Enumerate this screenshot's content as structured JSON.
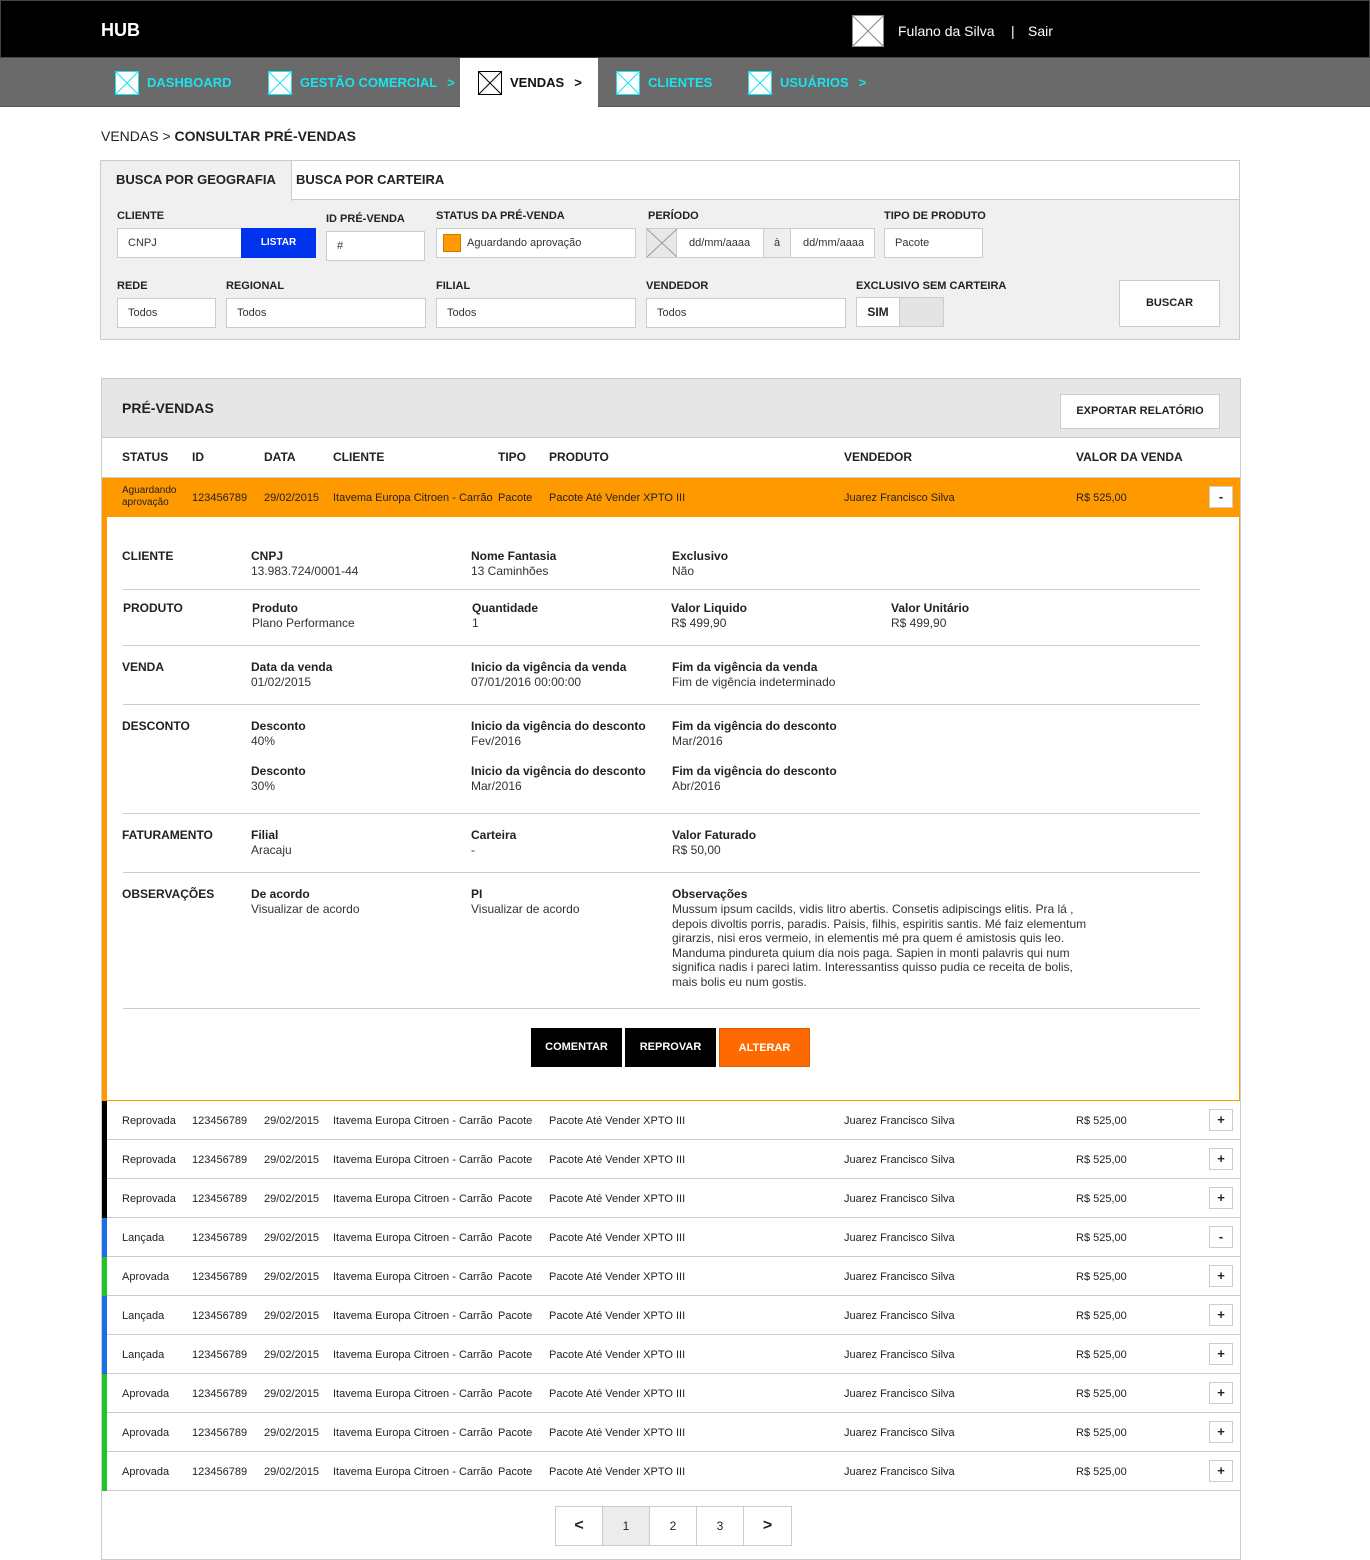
{
  "topbar": {
    "brand": "HUB",
    "user": "Fulano da Silva",
    "separator": "|",
    "logout": "Sair"
  },
  "nav": [
    {
      "label": "DASHBOARD",
      "chev": ""
    },
    {
      "label": "GESTÃO COMERCIAL",
      "chev": ">"
    },
    {
      "label": "VENDAS",
      "chev": ">"
    },
    {
      "label": "CLIENTES",
      "chev": ""
    },
    {
      "label": "USUÁRIOS",
      "chev": ">"
    }
  ],
  "breadcrumb": {
    "parent": "VENDAS >",
    "current": "CONSULTAR PRÉ-VENDAS"
  },
  "filters": {
    "tabs": [
      "BUSCA POR GEOGRAFIA",
      "BUSCA POR CARTEIRA"
    ],
    "cliente_label": "CLIENTE",
    "cliente_value": "CNPJ",
    "listar": "LISTAR",
    "id_label": "ID PRÉ-VENDA",
    "id_value": "#",
    "status_label": "STATUS DA PRÉ-VENDA",
    "status_value": "Aguardando aprovação",
    "periodo_label": "PERÍODO",
    "date_from": "dd/mm/aaaa",
    "date_sep": "à",
    "date_to": "dd/mm/aaaa",
    "tipo_label": "TIPO DE PRODUTO",
    "tipo_value": "Pacote",
    "rede_label": "REDE",
    "rede_value": "Todos",
    "regional_label": "REGIONAL",
    "regional_value": "Todos",
    "filial_label": "FILIAL",
    "filial_value": "Todos",
    "vendedor_label": "VENDEDOR",
    "vendedor_value": "Todos",
    "exclusivo_label": "EXCLUSIVO SEM CARTEIRA",
    "exclusivo_value": "SIM",
    "buscar": "BUSCAR"
  },
  "results": {
    "title": "PRÉ-VENDAS",
    "export": "EXPORTAR RELATÓRIO",
    "columns": [
      "STATUS",
      "ID",
      "DATA",
      "CLIENTE",
      "TIPO",
      "PRODUTO",
      "VENDEDOR",
      "VALOR DA VENDA"
    ],
    "open_row": {
      "status_line1": "Aguardando",
      "status_line2": "aprovação",
      "id": "123456789",
      "data": "29/02/2015",
      "cliente": "Itavema Europa Citroen - Carrão",
      "tipo": "Pacote",
      "produto": "Pacote Até Vender XPTO III",
      "vendedor": "Juarez Francisco Silva",
      "valor": "R$ 525,00",
      "toggle": "-"
    },
    "rows": [
      {
        "status": "Reprovada",
        "id": "123456789",
        "data": "29/02/2015",
        "cliente": "Itavema Europa Citroen - Carrão",
        "tipo": "Pacote",
        "produto": "Pacote Até Vender XPTO III",
        "vendedor": "Juarez Francisco Silva",
        "valor": "R$ 525,00",
        "toggle": "+",
        "color": "#000000"
      },
      {
        "status": "Reprovada",
        "id": "123456789",
        "data": "29/02/2015",
        "cliente": "Itavema Europa Citroen - Carrão",
        "tipo": "Pacote",
        "produto": "Pacote Até Vender XPTO III",
        "vendedor": "Juarez Francisco Silva",
        "valor": "R$ 525,00",
        "toggle": "+",
        "color": "#000000"
      },
      {
        "status": "Reprovada",
        "id": "123456789",
        "data": "29/02/2015",
        "cliente": "Itavema Europa Citroen - Carrão",
        "tipo": "Pacote",
        "produto": "Pacote Até Vender XPTO III",
        "vendedor": "Juarez Francisco Silva",
        "valor": "R$ 525,00",
        "toggle": "+",
        "color": "#000000"
      },
      {
        "status": "Lançada",
        "id": "123456789",
        "data": "29/02/2015",
        "cliente": "Itavema Europa Citroen - Carrão",
        "tipo": "Pacote",
        "produto": "Pacote Até Vender XPTO III",
        "vendedor": "Juarez Francisco Silva",
        "valor": "R$ 525,00",
        "toggle": "-",
        "color": "#1a6fe8"
      },
      {
        "status": "Aprovada",
        "id": "123456789",
        "data": "29/02/2015",
        "cliente": "Itavema Europa Citroen - Carrão",
        "tipo": "Pacote",
        "produto": "Pacote Até Vender XPTO III",
        "vendedor": "Juarez Francisco Silva",
        "valor": "R$ 525,00",
        "toggle": "+",
        "color": "#22c32a"
      },
      {
        "status": "Lançada",
        "id": "123456789",
        "data": "29/02/2015",
        "cliente": "Itavema Europa Citroen - Carrão",
        "tipo": "Pacote",
        "produto": "Pacote Até Vender XPTO III",
        "vendedor": "Juarez Francisco Silva",
        "valor": "R$ 525,00",
        "toggle": "+",
        "color": "#1a6fe8"
      },
      {
        "status": "Lançada",
        "id": "123456789",
        "data": "29/02/2015",
        "cliente": "Itavema Europa Citroen - Carrão",
        "tipo": "Pacote",
        "produto": "Pacote Até Vender XPTO III",
        "vendedor": "Juarez Francisco Silva",
        "valor": "R$ 525,00",
        "toggle": "+",
        "color": "#1a6fe8"
      },
      {
        "status": "Aprovada",
        "id": "123456789",
        "data": "29/02/2015",
        "cliente": "Itavema Europa Citroen - Carrão",
        "tipo": "Pacote",
        "produto": "Pacote Até Vender XPTO III",
        "vendedor": "Juarez Francisco Silva",
        "valor": "R$ 525,00",
        "toggle": "+",
        "color": "#22c32a"
      },
      {
        "status": "Aprovada",
        "id": "123456789",
        "data": "29/02/2015",
        "cliente": "Itavema Europa Citroen - Carrão",
        "tipo": "Pacote",
        "produto": "Pacote Até Vender XPTO III",
        "vendedor": "Juarez Francisco Silva",
        "valor": "R$ 525,00",
        "toggle": "+",
        "color": "#22c32a"
      },
      {
        "status": "Aprovada",
        "id": "123456789",
        "data": "29/02/2015",
        "cliente": "Itavema Europa Citroen - Carrão",
        "tipo": "Pacote",
        "produto": "Pacote Até Vender XPTO III",
        "vendedor": "Juarez Francisco Silva",
        "valor": "R$ 525,00",
        "toggle": "+",
        "color": "#22c32a"
      }
    ],
    "pagination": [
      "<",
      "1",
      "2",
      "3",
      ">"
    ]
  },
  "detail": {
    "cliente": {
      "section": "CLIENTE",
      "cnpj_l": "CNPJ",
      "cnpj_v": "13.983.724/0001-44",
      "fantasia_l": "Nome Fantasia",
      "fantasia_v": "13 Caminhões",
      "exclusivo_l": "Exclusivo",
      "exclusivo_v": "Não"
    },
    "produto": {
      "section": "PRODUTO",
      "produto_l": "Produto",
      "produto_v": "Plano Performance",
      "qtd_l": "Quantidade",
      "qtd_v": "1",
      "liq_l": "Valor Liquido",
      "liq_v": "R$ 499,90",
      "unit_l": "Valor Unitário",
      "unit_v": "R$ 499,90"
    },
    "venda": {
      "section": "VENDA",
      "data_l": "Data da venda",
      "data_v": "01/02/2015",
      "ini_l": "Inicio da vigência da venda",
      "ini_v": "07/01/2016 00:00:00",
      "fim_l": "Fim da vigência da venda",
      "fim_v": "Fim de vigência indeterminado"
    },
    "desconto": {
      "section": "DESCONTO",
      "items": [
        {
          "desc_l": "Desconto",
          "desc_v": "40%",
          "ini_l": "Inicio da vigência do desconto",
          "ini_v": "Fev/2016",
          "fim_l": "Fim da vigência do desconto",
          "fim_v": "Mar/2016"
        },
        {
          "desc_l": "Desconto",
          "desc_v": "30%",
          "ini_l": "Inicio da vigência do desconto",
          "ini_v": "Mar/2016",
          "fim_l": "Fim da vigência do desconto",
          "fim_v": "Abr/2016"
        }
      ]
    },
    "faturamento": {
      "section": "FATURAMENTO",
      "filial_l": "Filial",
      "filial_v": "Aracaju",
      "carteira_l": "Carteira",
      "carteira_v": "-",
      "fat_l": "Valor Faturado",
      "fat_v": "R$ 50,00"
    },
    "observacoes": {
      "section": "OBSERVAÇÕES",
      "acordo_l": "De acordo",
      "acordo_v": "Visualizar de acordo",
      "pi_l": "PI",
      "pi_v": "Visualizar de acordo",
      "obs_l": "Observações",
      "obs_v": "Mussum ipsum cacilds, vidis litro abertis. Consetis adipiscings elitis. Pra lá , depois divoltis porris, paradis. Paisis, filhis, espiritis santis. Mé faiz elementum girarzis, nisi eros vermeio, in elementis mé pra quem é amistosis quis leo. Manduma pindureta quium dia nois paga. Sapien in monti palavris qui num significa nadis i pareci latim. Interessantiss quisso pudia ce receita de bolis, mais bolis eu num gostis."
    },
    "actions": {
      "comentar": "COMENTAR",
      "reprovar": "REPROVAR",
      "alterar": "ALTERAR"
    }
  },
  "colors": {
    "topbar": "#000000",
    "nav": "#6a6a6a",
    "nav_text": "#17e4ee",
    "pending": "#ff9900",
    "rejected": "#000000",
    "launched": "#1a6fe8",
    "approved": "#22c32a",
    "listar": "#0033ee",
    "alterar": "#ff6a00"
  }
}
